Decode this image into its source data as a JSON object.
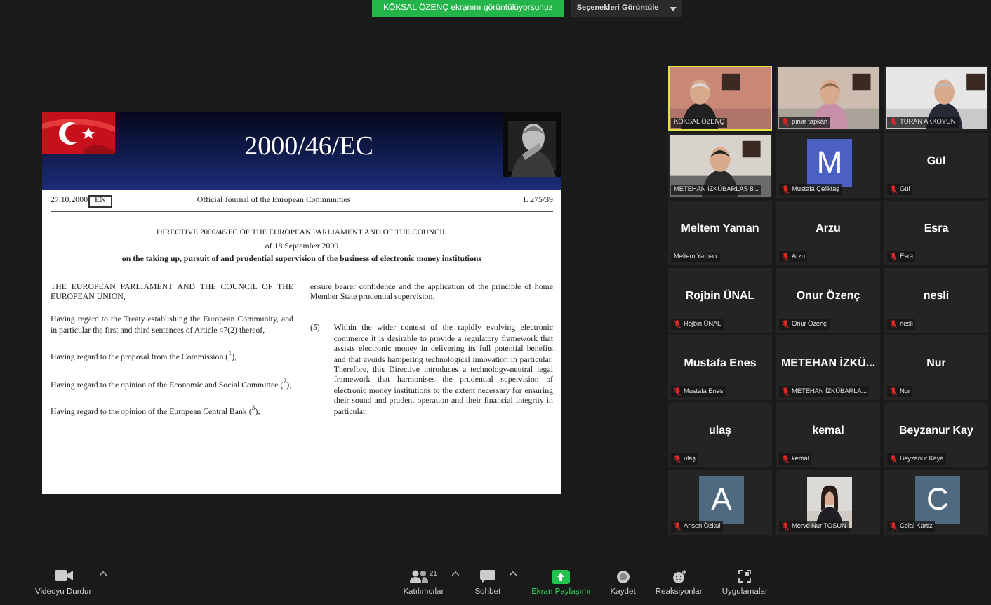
{
  "top_bar": {
    "banner": "KÖKSAL ÖZENÇ ekranını görüntülüyorsunuz",
    "options_button": "Seçenekleri Görüntüle"
  },
  "slide": {
    "title": "2000/46/EC",
    "document": {
      "date": "27.10.2000",
      "language": "EN",
      "journal": "Official Journal of the European Communities",
      "page": "L 275/39",
      "heading": [
        "DIRECTIVE 2000/46/EC OF THE EUROPEAN PARLIAMENT AND OF THE COUNCIL",
        "of 18 September 2000",
        "on the taking up, pursuit of and prudential supervision of the business of electronic money institutions"
      ],
      "left_paragraphs": [
        "THE EUROPEAN PARLIAMENT AND THE COUNCIL OF THE EUROPEAN UNION,",
        "Having regard to the Treaty establishing the European Community, and in particular the first and third sentences of Article 47(2) thereof,",
        "Having regard to the proposal from the Commission ($^{1}$),",
        "Having regard to the opinion of the Economic and Social Committee ($^{2}$),",
        "Having regard to the opinion of the European Central Bank ($^{3}$),"
      ],
      "right_paragraphs": [
        {
          "text": "ensure bearer confidence and the application of the principle of home Member State prudential supervision."
        },
        {
          "number": "(5)",
          "text": "Within the wider context of the rapidly evolving electronic commerce it is desirable to provide a regulatory framework that assists electronic money in delivering its full potential benefits and that avoids hampering technological innovation in particular. Therefore, this Directive introduces a technology-neutral legal framework that harmonises the prudential supervision of electronic money institutions to the extent necessary for ensuring their sound and prudent operation and their financial integrity in particular."
        }
      ]
    }
  },
  "tiles": [
    {
      "kind": "video",
      "label": "KÖKSAL ÖZENÇ",
      "muted": false,
      "selected": true
    },
    {
      "kind": "video",
      "label": "pınar tapkan",
      "muted": true,
      "selected": false
    },
    {
      "kind": "video",
      "label": "TURAN AKKOYUN",
      "muted": true,
      "selected": false
    },
    {
      "kind": "video",
      "label": "METEHAN İZKÜBARLAS 8...",
      "muted": false,
      "selected": false
    },
    {
      "kind": "avatar",
      "initial": "M",
      "color": "#4c5fc2",
      "label": "Mustafa Çeliktaş",
      "muted": true,
      "selected": false
    },
    {
      "kind": "name",
      "display_name": "Gül",
      "label": "Gül",
      "muted": true,
      "selected": false
    },
    {
      "kind": "name",
      "display_name": "Meltem Yaman",
      "label": "Meltem Yaman",
      "muted": false,
      "selected": false
    },
    {
      "kind": "name",
      "display_name": "Arzu",
      "label": "Arzu",
      "muted": true,
      "selected": false
    },
    {
      "kind": "name",
      "display_name": "Esra",
      "label": "Esra",
      "muted": true,
      "selected": false
    },
    {
      "kind": "name",
      "display_name": "Rojbin ÜNAL",
      "label": "Rojbin ÜNAL",
      "muted": true,
      "selected": false
    },
    {
      "kind": "name",
      "display_name": "Onur Özenç",
      "label": "Onur Özenç",
      "muted": true,
      "selected": false
    },
    {
      "kind": "name",
      "display_name": "nesli",
      "label": "nesli",
      "muted": true,
      "selected": false
    },
    {
      "kind": "name",
      "display_name": "Mustafa Enes",
      "label": "Mustafa Enes",
      "muted": true,
      "selected": false
    },
    {
      "kind": "name",
      "display_name": "METEHAN  İZKÜ...",
      "label": "METEHAN İZKÜBARLA...",
      "muted": true,
      "selected": false
    },
    {
      "kind": "name",
      "display_name": "Nur",
      "label": "Nur",
      "muted": true,
      "selected": false
    },
    {
      "kind": "name",
      "display_name": "ulaş",
      "label": "ulaş",
      "muted": true,
      "selected": false
    },
    {
      "kind": "name",
      "display_name": "kemal",
      "label": "kemal",
      "muted": true,
      "selected": false
    },
    {
      "kind": "name",
      "display_name": "Beyzanur Kay",
      "label": "Beyzanur Kaya",
      "muted": true,
      "selected": false
    },
    {
      "kind": "avatar",
      "initial": "A",
      "color": "#4f6a80",
      "label": "Ahsen Özkul",
      "muted": true,
      "selected": false
    },
    {
      "label": "Merve Nur TOSUN",
      "muted": true,
      "selected": false
    },
    {
      "kind": "avatar",
      "initial": "C",
      "color": "#4f6a80",
      "label": "Celal Kartiz",
      "muted": true,
      "selected": false
    }
  ],
  "toolbar": [
    {
      "kind": "video",
      "label": "Videoyu Durdur",
      "caret": true,
      "selected": false
    },
    {
      "kind": "people",
      "label": "Katılımcılar",
      "count": "21",
      "caret": true,
      "selected": false
    },
    {
      "kind": "chat",
      "label": "Sohbet",
      "caret": true,
      "selected": false
    },
    {
      "kind": "share",
      "label": "Ekran Paylaşımı",
      "caret": false,
      "selected": true
    },
    {
      "kind": "record",
      "label": "Kaydet",
      "caret": false,
      "selected": false
    },
    {
      "kind": "reactions",
      "label": "Reaksiyonlar",
      "caret": false,
      "selected": false
    },
    {
      "kind": "apps",
      "label": "Uygulamalar",
      "caret": false,
      "selected": false
    }
  ]
}
